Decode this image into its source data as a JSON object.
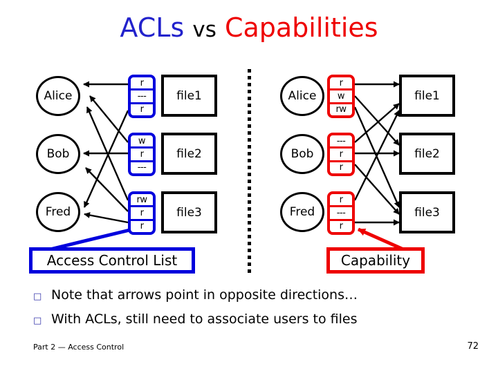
{
  "title": {
    "part_acls": "ACLs",
    "part_vs": "vs",
    "part_capabilities": "Capabilities",
    "color_acls": "#2222cc",
    "color_vs": "#000000",
    "color_capabilities": "#ee0000"
  },
  "acl_side": {
    "accent_color": "#0000dd",
    "subjects": [
      "Alice",
      "Bob",
      "Fred"
    ],
    "files": [
      "file1",
      "file2",
      "file3"
    ],
    "columns": [
      {
        "file": "file1",
        "perms": [
          "r",
          "---",
          "r"
        ]
      },
      {
        "file": "file2",
        "perms": [
          "w",
          "r",
          "---"
        ]
      },
      {
        "file": "file3",
        "perms": [
          "rw",
          "r",
          "r"
        ]
      }
    ],
    "callout_label": "Access Control List"
  },
  "capability_side": {
    "accent_color": "#ee0000",
    "subjects": [
      "Alice",
      "Bob",
      "Fred"
    ],
    "files": [
      "file1",
      "file2",
      "file3"
    ],
    "rows": [
      {
        "subject": "Alice",
        "perms": [
          "r",
          "w",
          "rw"
        ]
      },
      {
        "subject": "Bob",
        "perms": [
          "---",
          "r",
          "r"
        ]
      },
      {
        "subject": "Fred",
        "perms": [
          "r",
          "---",
          "r"
        ]
      }
    ],
    "callout_label": "Capability"
  },
  "bullets": [
    {
      "mark": "q",
      "text": "Note that arrows point in opposite directions…"
    },
    {
      "mark": "q",
      "text": "With ACLs, still need to associate users to files"
    }
  ],
  "footer": {
    "left": "Part 2 — Access Control",
    "right": "72"
  }
}
